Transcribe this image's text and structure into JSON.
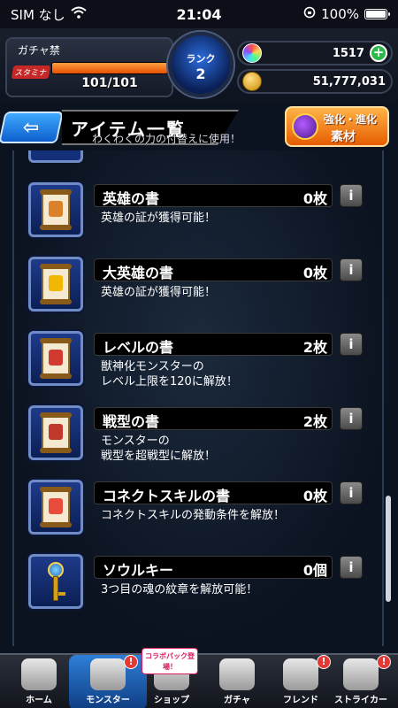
{
  "status_bar": {
    "carrier": "SIM なし",
    "time": "21:04",
    "battery": "100%",
    "battery_level": 1.0
  },
  "header": {
    "gacha_label": "ガチャ禁",
    "stamina_label": "スタミナ",
    "stamina_text": "101/101",
    "stamina_fraction": 1.0,
    "rank_label": "ランク",
    "rank_value": "2",
    "orbs": "1517",
    "gold": "51,777,031"
  },
  "title": {
    "back_arrow": "⇦",
    "text": "アイテム一覧",
    "ghost_text": "わくわくの力の付替えに使用！",
    "power_button_line1": "強化・進化",
    "power_button_line2": "素材"
  },
  "items": [
    {
      "name": "英雄の書",
      "count": "0枚",
      "description": "英雄の証が獲得可能！",
      "emblem_color": "#d9822b"
    },
    {
      "name": "大英雄の書",
      "count": "0枚",
      "description": "英雄の証が獲得可能！",
      "emblem_color": "#f2b705"
    },
    {
      "name": "レベルの書",
      "count": "2枚",
      "description": "獣神化モンスターの\nレベル上限を120に解放！",
      "emblem_color": "#d33a2f"
    },
    {
      "name": "戦型の書",
      "count": "2枚",
      "description": "モンスターの\n戦型を超戦型に解放！",
      "emblem_color": "#c0392b"
    },
    {
      "name": "コネクトスキルの書",
      "count": "0枚",
      "description": "コネクトスキルの発動条件を解放！",
      "emblem_color": "#e74c3c"
    },
    {
      "name": "ソウルキー",
      "count": "0個",
      "description": "3つ目の魂の紋章を解放可能！",
      "icon": "key-icon"
    }
  ],
  "info_label": "i",
  "nav": [
    {
      "label": "ホーム",
      "icon": "home-icon",
      "badge": ""
    },
    {
      "label": "モンスター",
      "icon": "monster-icon",
      "badge": "!"
    },
    {
      "label": "ショップ",
      "icon": "cart-icon",
      "badge": "",
      "collab": "コラボパック登場！"
    },
    {
      "label": "ガチャ",
      "icon": "gacha-icon",
      "badge": ""
    },
    {
      "label": "フレンド",
      "icon": "friend-icon",
      "badge": "!"
    },
    {
      "label": "ストライカー",
      "icon": "striker-icon",
      "badge": "!"
    }
  ],
  "colors": {
    "accent": "#2e7fd8",
    "stamina": "#e65100",
    "plus": "#2db84a",
    "badge": "#e53935"
  }
}
